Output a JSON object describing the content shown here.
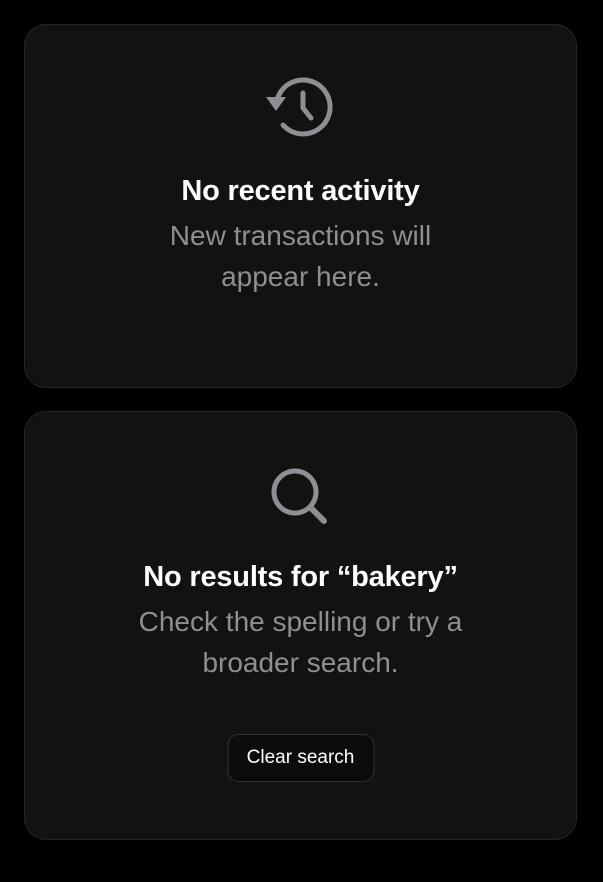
{
  "colors": {
    "background": "#000000",
    "card_background": "#121212",
    "card_border": "#262626",
    "title_text": "#ffffff",
    "body_text": "#8e8e93",
    "icon": "#8e8e93"
  },
  "activity_empty_state": {
    "icon": "history-icon",
    "title": "No recent activity",
    "message": "New transactions will appear here."
  },
  "search_empty_state": {
    "icon": "search-icon",
    "title": "No results for “bakery”",
    "message": "Check the spelling or try a broader search.",
    "clear_button_label": "Clear search"
  }
}
